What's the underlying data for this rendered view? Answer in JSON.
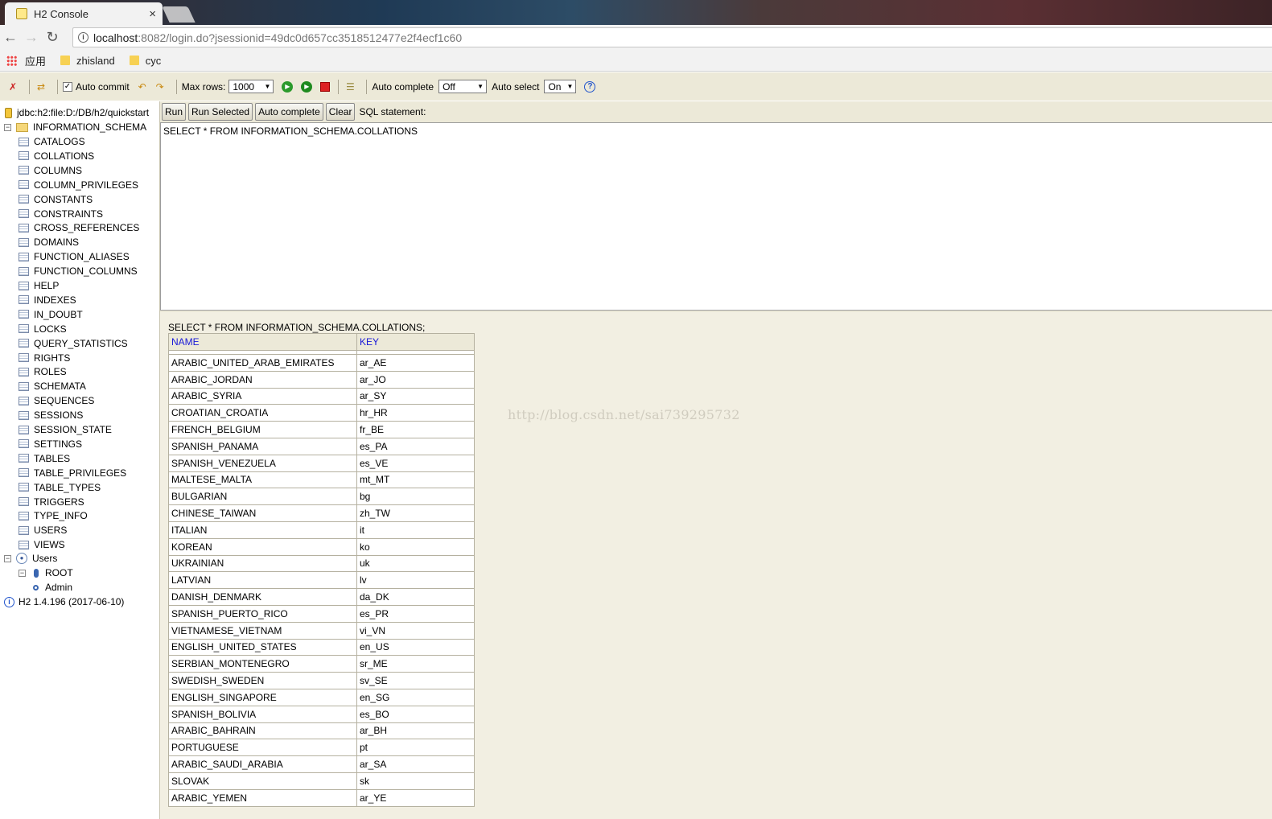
{
  "browser": {
    "tab_title": "H2 Console",
    "tab_close": "×",
    "url_host": "localhost",
    "url_rest": ":8082/login.do?jsessionid=49dc0d657cc3518512477e2f4ecf1c60",
    "bookmarks": [
      "应用",
      "zhisland",
      "cyc"
    ]
  },
  "toolbar": {
    "auto_commit_label": "Auto commit",
    "max_rows_label": "Max rows:",
    "max_rows_value": "1000",
    "auto_complete_label": "Auto complete",
    "auto_complete_value": "Off",
    "auto_select_label": "Auto select",
    "auto_select_value": "On"
  },
  "tree": {
    "connection": "jdbc:h2:file:D:/DB/h2/quickstart",
    "schema": "INFORMATION_SCHEMA",
    "tables": [
      "CATALOGS",
      "COLLATIONS",
      "COLUMNS",
      "COLUMN_PRIVILEGES",
      "CONSTANTS",
      "CONSTRAINTS",
      "CROSS_REFERENCES",
      "DOMAINS",
      "FUNCTION_ALIASES",
      "FUNCTION_COLUMNS",
      "HELP",
      "INDEXES",
      "IN_DOUBT",
      "LOCKS",
      "QUERY_STATISTICS",
      "RIGHTS",
      "ROLES",
      "SCHEMATA",
      "SEQUENCES",
      "SESSIONS",
      "SESSION_STATE",
      "SETTINGS",
      "TABLES",
      "TABLE_PRIVILEGES",
      "TABLE_TYPES",
      "TRIGGERS",
      "TYPE_INFO",
      "USERS",
      "VIEWS"
    ],
    "users_label": "Users",
    "user_root": "ROOT",
    "user_admin": "Admin",
    "version": "H2 1.4.196 (2017-06-10)"
  },
  "query": {
    "buttons": [
      "Run",
      "Run Selected",
      "Auto complete",
      "Clear"
    ],
    "sql_label": "SQL statement:",
    "sql_text": "SELECT * FROM INFORMATION_SCHEMA.COLLATIONS"
  },
  "results": {
    "query_echo": "SELECT * FROM INFORMATION_SCHEMA.COLLATIONS;",
    "columns": [
      "NAME",
      "KEY"
    ],
    "rows": [
      [
        "ARABIC_UNITED_ARAB_EMIRATES",
        "ar_AE"
      ],
      [
        "ARABIC_JORDAN",
        "ar_JO"
      ],
      [
        "ARABIC_SYRIA",
        "ar_SY"
      ],
      [
        "CROATIAN_CROATIA",
        "hr_HR"
      ],
      [
        "FRENCH_BELGIUM",
        "fr_BE"
      ],
      [
        "SPANISH_PANAMA",
        "es_PA"
      ],
      [
        "SPANISH_VENEZUELA",
        "es_VE"
      ],
      [
        "MALTESE_MALTA",
        "mt_MT"
      ],
      [
        "BULGARIAN",
        "bg"
      ],
      [
        "CHINESE_TAIWAN",
        "zh_TW"
      ],
      [
        "ITALIAN",
        "it"
      ],
      [
        "KOREAN",
        "ko"
      ],
      [
        "UKRAINIAN",
        "uk"
      ],
      [
        "LATVIAN",
        "lv"
      ],
      [
        "DANISH_DENMARK",
        "da_DK"
      ],
      [
        "SPANISH_PUERTO_RICO",
        "es_PR"
      ],
      [
        "VIETNAMESE_VIETNAM",
        "vi_VN"
      ],
      [
        "ENGLISH_UNITED_STATES",
        "en_US"
      ],
      [
        "SERBIAN_MONTENEGRO",
        "sr_ME"
      ],
      [
        "SWEDISH_SWEDEN",
        "sv_SE"
      ],
      [
        "ENGLISH_SINGAPORE",
        "en_SG"
      ],
      [
        "SPANISH_BOLIVIA",
        "es_BO"
      ],
      [
        "ARABIC_BAHRAIN",
        "ar_BH"
      ],
      [
        "PORTUGUESE",
        "pt"
      ],
      [
        "ARABIC_SAUDI_ARABIA",
        "ar_SA"
      ],
      [
        "SLOVAK",
        "sk"
      ],
      [
        "ARABIC_YEMEN",
        "ar_YE"
      ]
    ]
  },
  "watermark": "http://blog.csdn.net/sai739295732"
}
